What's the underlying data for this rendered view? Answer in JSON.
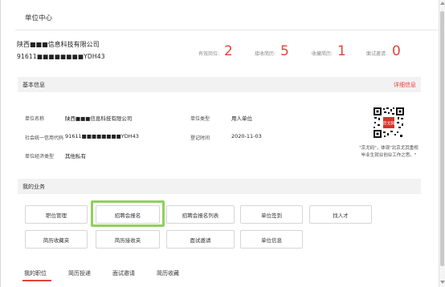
{
  "header": {
    "title": "单位中心"
  },
  "company": {
    "name": "陕西■■■信息科技有限公司",
    "code": "91611■■■■■■■■YDH43"
  },
  "stats": [
    {
      "label": "有效岗位:",
      "value": "2"
    },
    {
      "label": "接收简历:",
      "value": "5"
    },
    {
      "label": "收藏简历:",
      "value": "1"
    },
    {
      "label": "面试邀请:",
      "value": "0"
    }
  ],
  "basic_info": {
    "section_title": "基本信息",
    "detail_link": "详细信息",
    "fields": [
      {
        "label": "单位名称",
        "value": "陕西■■■信息科技有限公司"
      },
      {
        "label": "单位类型",
        "value": "用人单位"
      },
      {
        "label": "社会统一信用代码",
        "value": "91611■■■■■■■■YDH43"
      },
      {
        "label": "登记时间",
        "value": "2020-11-03"
      },
      {
        "label": "单位经济类型",
        "value": "其他私有"
      }
    ],
    "qr_badge": "京尤码",
    "qr_caption_line1": "\"京尤码\"，体现\"北京尤其重视",
    "qr_caption_line2": "毕业生就业创业工作之思。\""
  },
  "business": {
    "section_title": "我的业务",
    "buttons": [
      "职位管理",
      "招聘会报名",
      "招聘会报名列表",
      "单位签到",
      "找人才",
      "简历收藏夹",
      "简历接收夹",
      "面试邀请",
      "单位信息"
    ]
  },
  "tabs": [
    "我的职位",
    "简历投递",
    "面试邀请",
    "简历收藏"
  ],
  "colors": {
    "accent": "#e3443a",
    "highlight": "#8fd05c",
    "section_bg": "#f2f2f2"
  }
}
